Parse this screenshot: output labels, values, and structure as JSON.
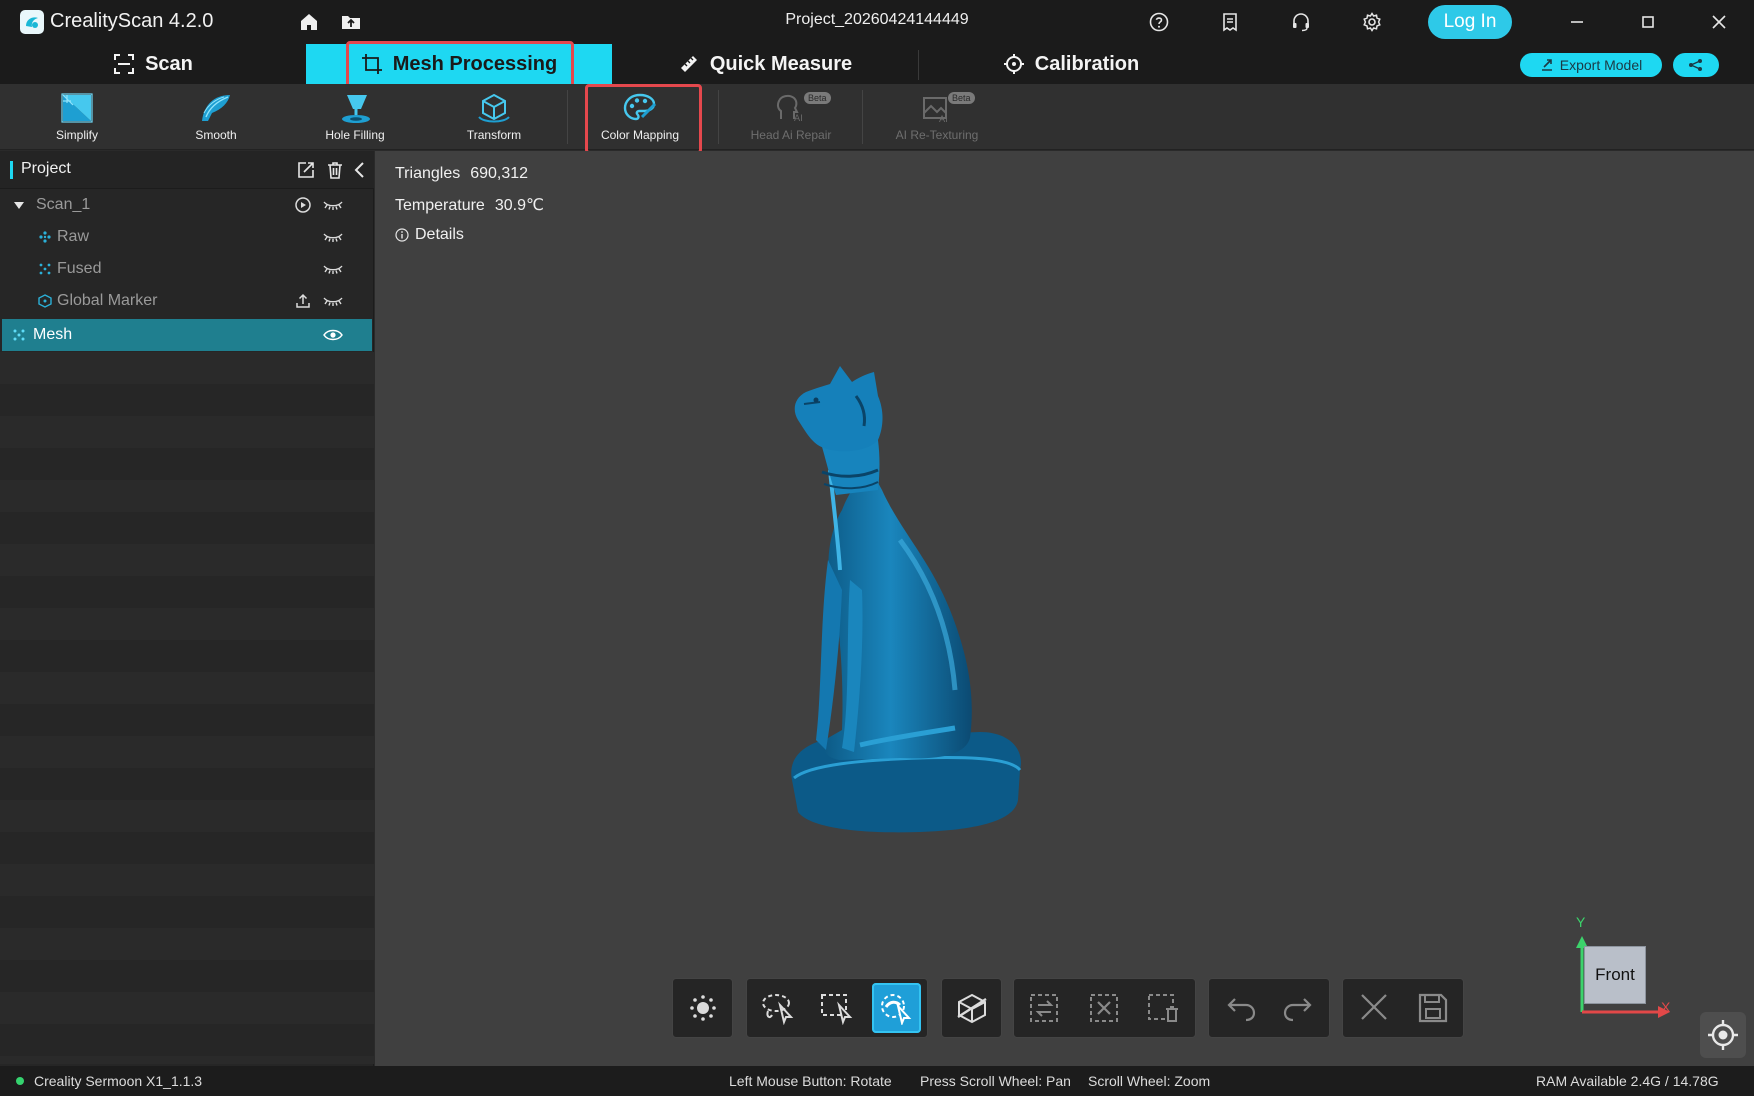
{
  "app": {
    "title": "CrealityScan 4.2.0",
    "project_name": "Project_20260424144449",
    "login_label": "Log In"
  },
  "modes": [
    {
      "label": "Scan",
      "icon": "scan-frame-icon"
    },
    {
      "label": "Mesh Processing",
      "icon": "crop-icon",
      "active": true
    },
    {
      "label": "Quick Measure",
      "icon": "ruler-icon"
    },
    {
      "label": "Calibration",
      "icon": "crosshair-icon"
    }
  ],
  "actions": {
    "export_label": "Export Model"
  },
  "tools": [
    {
      "label": "Simplify",
      "icon": "simplify-icon"
    },
    {
      "label": "Smooth",
      "icon": "smooth-icon"
    },
    {
      "label": "Hole Filling",
      "icon": "hole-filling-icon"
    },
    {
      "label": "Transform",
      "icon": "transform-icon"
    },
    {
      "label": "Color Mapping",
      "icon": "palette-icon",
      "highlighted": true
    },
    {
      "label": "Head Ai Repair",
      "icon": "head-ai-repair-icon",
      "disabled": true,
      "badge": "Beta"
    },
    {
      "label": "AI Re-Texturing",
      "icon": "ai-retexturing-icon",
      "disabled": true,
      "badge": "Beta"
    }
  ],
  "panel": {
    "title": "Project",
    "tree": [
      {
        "name": "Scan_1",
        "expanded": true
      },
      {
        "name": "Raw"
      },
      {
        "name": "Fused"
      },
      {
        "name": "Global Marker"
      },
      {
        "name": "Mesh",
        "selected": true,
        "visible": true
      }
    ]
  },
  "stats": {
    "triangles_label": "Triangles",
    "triangles_value": "690,312",
    "temperature_label": "Temperature",
    "temperature_value": "30.9℃",
    "details_label": "Details"
  },
  "view": {
    "cube_label": "Front",
    "axis_y": "Y",
    "axis_x": "X"
  },
  "status": {
    "device": "Creality Sermoon X1_1.1.3",
    "hint_rotate": "Left Mouse Button: Rotate",
    "hint_pan": "Press Scroll Wheel: Pan",
    "hint_zoom": "Scroll Wheel: Zoom",
    "ram": "RAM Available 2.4G / 14.78G"
  },
  "colors": {
    "accent": "#1ed8f2",
    "highlight": "#e5484d",
    "mesh": "#1276ad",
    "selected_row": "#1f7f8f"
  }
}
